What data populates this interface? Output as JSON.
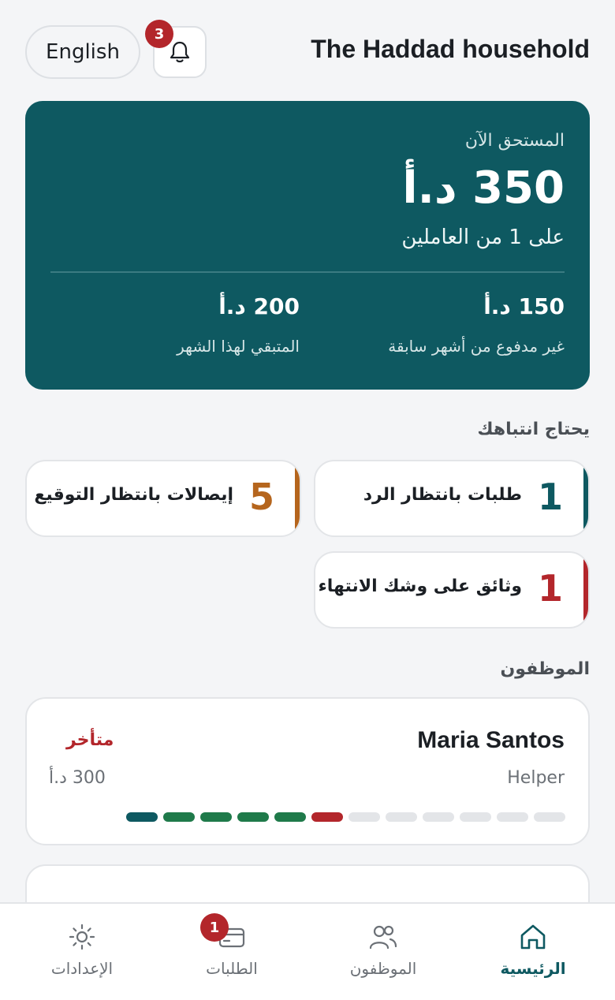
{
  "header": {
    "language_button": "English",
    "notifications_count": "3",
    "household_name": "The Haddad household"
  },
  "summary": {
    "due_now_label": "المستحق الآن",
    "due_now_amount": "350 د.أ",
    "due_now_sub": "على 1 من العاملين",
    "unpaid_previous_amount": "150 د.أ",
    "unpaid_previous_label": "غير مدفوع من أشهر سابقة",
    "remaining_month_amount": "200 د.أ",
    "remaining_month_label": "المتبقي لهذا الشهر",
    "colors": {
      "card_bg": "#0e5961"
    }
  },
  "attention": {
    "title": "يحتاج انتباهك",
    "items": [
      {
        "count": "1",
        "label": "طلبات بانتظار الرد",
        "color": "#0e5961"
      },
      {
        "count": "5",
        "label": "إيصالات بانتظار التوقيع",
        "color": "#b5651d"
      },
      {
        "count": "1",
        "label": "وثائق على وشك الانتهاء",
        "color": "#b3262b"
      }
    ]
  },
  "employees": {
    "title": "الموظفون",
    "list": [
      {
        "name": "Maria Santos",
        "role": "Helper",
        "status": "متأخر",
        "amount": "300 د.أ",
        "month_status": [
          "paid",
          "paid-on-time",
          "paid-on-time",
          "paid-on-time",
          "paid-on-time",
          "late",
          "pending",
          "pending",
          "pending",
          "pending",
          "pending",
          "pending"
        ]
      }
    ]
  },
  "status_colors": {
    "paid": "#0e5961",
    "paid-on-time": "#1f7a4a",
    "late": "#b3262b",
    "pending": "#e3e5e8"
  },
  "nav": {
    "home": "الرئيسية",
    "employees": "الموظفون",
    "requests": "الطلبات",
    "requests_badge": "1",
    "settings": "الإعدادات",
    "active": "home"
  }
}
